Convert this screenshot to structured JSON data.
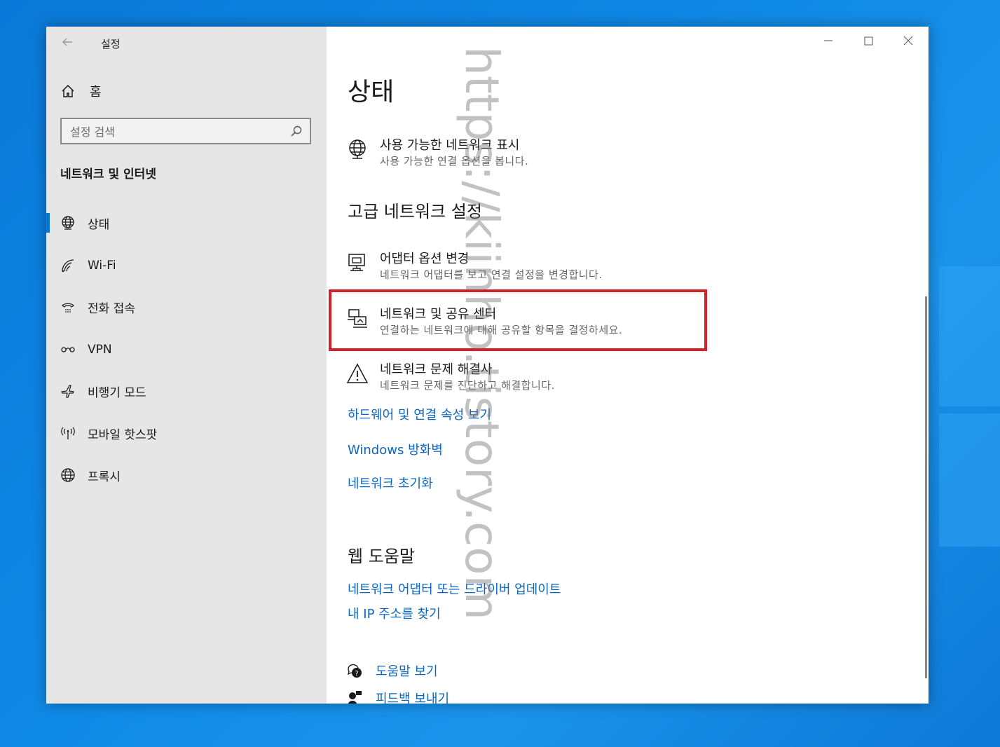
{
  "window": {
    "app_title": "설정",
    "controls": {
      "minimize": "minimize",
      "maximize": "maximize",
      "close": "close"
    }
  },
  "sidebar": {
    "home_label": "홈",
    "search_placeholder": "설정 검색",
    "section_title": "네트워크 및 인터넷",
    "items": [
      {
        "label": "상태",
        "icon": "globe-network-icon",
        "active": true
      },
      {
        "label": "Wi-Fi",
        "icon": "wifi-icon",
        "active": false
      },
      {
        "label": "전화 접속",
        "icon": "dialup-icon",
        "active": false
      },
      {
        "label": "VPN",
        "icon": "vpn-icon",
        "active": false
      },
      {
        "label": "비행기 모드",
        "icon": "airplane-icon",
        "active": false
      },
      {
        "label": "모바일 핫스팟",
        "icon": "hotspot-icon",
        "active": false
      },
      {
        "label": "프록시",
        "icon": "globe-icon",
        "active": false
      }
    ]
  },
  "main": {
    "page_title": "상태",
    "show_networks": {
      "title": "사용 가능한 네트워크 표시",
      "desc": "사용 가능한 연결 옵션을 봅니다."
    },
    "advanced_title": "고급 네트워크 설정",
    "options": [
      {
        "title": "어댑터 옵션 변경",
        "desc": "네트워크 어댑터를 보고 연결 설정을 변경합니다."
      },
      {
        "title": "네트워크 및 공유 센터",
        "desc": "연결하는 네트워크에 대해 공유할 항목을 결정하세요."
      },
      {
        "title": "네트워크 문제 해결사",
        "desc": "네트워크 문제를 진단하고 해결합니다."
      }
    ],
    "links": [
      "하드웨어 및 연결 속성 보기",
      "Windows 방화벽",
      "네트워크 초기화"
    ],
    "web_help_title": "웹 도움말",
    "web_links": [
      "네트워크 어댑터 또는 드라이버 업데이트",
      "내 IP 주소를 찾기"
    ],
    "help_links": [
      "도움말 보기",
      "피드백 보내기"
    ]
  },
  "watermark": "https://kiinho.tistory.com",
  "colors": {
    "accent": "#0a74d0",
    "link": "#0b66c2",
    "highlight": "#d32027",
    "sidebar_bg": "#e6e6e6"
  }
}
